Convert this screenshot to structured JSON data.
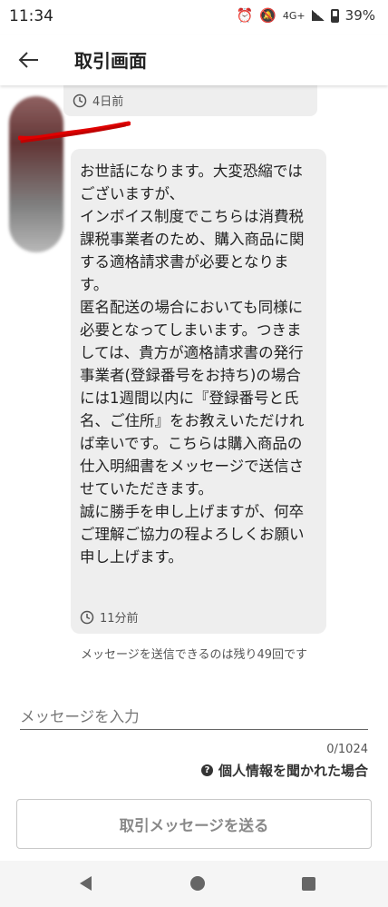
{
  "status": {
    "time": "11:34",
    "network": "4G+",
    "battery": "39%",
    "icons": [
      "alarm-icon",
      "bell-off-icon",
      "signal-icon",
      "battery-icon"
    ]
  },
  "header": {
    "title": "取引画面",
    "back_icon": "arrow-left-icon"
  },
  "messages": [
    {
      "time": "4日前"
    },
    {
      "text": "お世話になります。大変恐縮ではございますが、\nインボイス制度でこちらは消費税課税事業者のため、購入商品に関する適格請求書が必要となります。\n匿名配送の場合においても同様に必要となってしまいます。つきましては、貴方が適格請求書の発行事業者(登録番号をお持ち)の場合には1週間以内に『登録番号と氏名、ご住所』をお教えいただければ幸いです。こちらは購入商品の仕入明細書をメッセージで送信させていただきます。\n誠に勝手を申し上げますが、何卒ご理解ご協力の程よろしくお願い申し上げます。",
      "time": "11分前"
    }
  ],
  "remaining_note": "メッセージを送信できるのは残り49回です",
  "input": {
    "placeholder": "メッセージを入力",
    "value": "",
    "counter": "0/1024"
  },
  "privacy_link": "個人情報を聞かれた場合",
  "send_button": "取引メッセージを送る",
  "colors": {
    "bubble": "#eeeeee",
    "scribble": "#e00000",
    "button_text": "#888888"
  }
}
